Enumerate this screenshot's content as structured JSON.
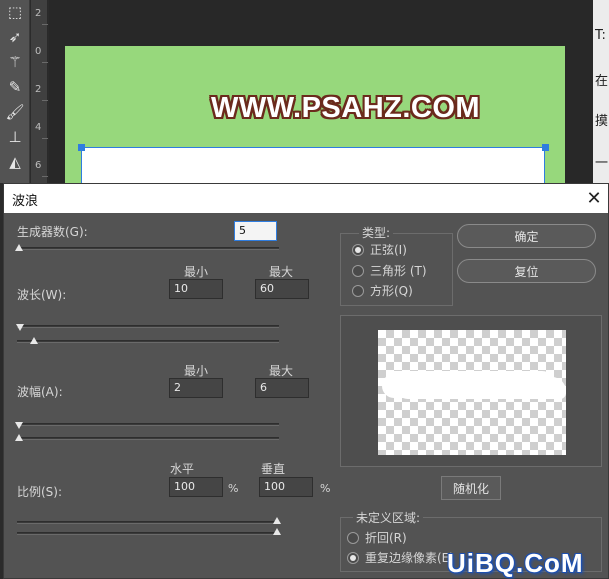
{
  "workspace": {
    "ruler_numbers": [
      "2",
      "0",
      "2",
      "4",
      "6"
    ],
    "canvas_text": "WWW.PSAHZ.COM",
    "right_panel_chars": [
      "T:",
      "在",
      "摸",
      "一"
    ],
    "colors": {
      "artboard": "#97d87c",
      "selection": "#2f7de0",
      "text_outline": "#6b2a1c"
    },
    "tools": [
      "marquee-icon",
      "lasso-icon",
      "magic-wand-icon",
      "eyedropper-icon",
      "brush-icon",
      "stamp-icon",
      "eraser-icon"
    ]
  },
  "dialog": {
    "title": "波浪",
    "generators": {
      "label": "生成器数(G):",
      "value": "5",
      "level": 0.0
    },
    "headers": {
      "min": "最小",
      "max": "最大",
      "horizontal": "水平",
      "vertical": "垂直"
    },
    "wavelength": {
      "label": "波长(W):",
      "min": "10",
      "max": "60"
    },
    "amplitude": {
      "label": "波幅(A):",
      "min": "2",
      "max": "6"
    },
    "scale": {
      "label": "比例(S):",
      "horizontal": "100",
      "vertical": "100",
      "unit": "%"
    },
    "type": {
      "legend": "类型:",
      "options": [
        {
          "label": "正弦(I)",
          "checked": true
        },
        {
          "label": "三角形 (T)",
          "checked": false
        },
        {
          "label": "方形(Q)",
          "checked": false
        }
      ]
    },
    "buttons": {
      "ok": "确定",
      "reset": "复位",
      "randomize": "随机化"
    },
    "undefined_areas": {
      "legend": "未定义区域:",
      "options": [
        {
          "label": "折回(R)",
          "checked": false
        },
        {
          "label": "重复边缘像素(E)",
          "checked": true
        }
      ]
    }
  },
  "watermark": "UiBQ.CoM"
}
